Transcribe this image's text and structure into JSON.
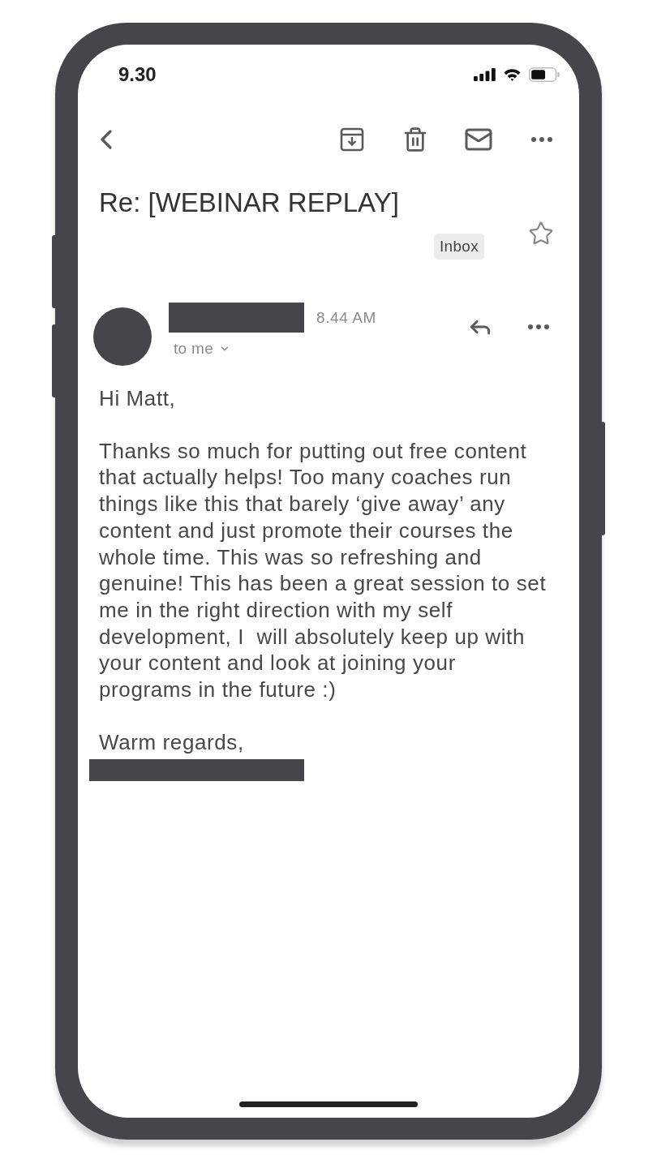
{
  "status_bar": {
    "time": "9.30"
  },
  "message": {
    "subject": "Re: [WEBINAR REPLAY]",
    "label": "Inbox",
    "starred": false,
    "sender": {
      "time": "8.44 AM",
      "recipient": "to me"
    },
    "body": {
      "greeting": "Hi Matt,",
      "paragraph_lines": [
        "Thanks so much for putting out free content",
        "that actually helps! Too many coaches run",
        "things like this that barely ‘give away’ any",
        "content and just promote their courses the",
        "whole time. This was so refreshing and",
        "genuine! This has been a great session to set",
        "me in the right direction with my self",
        "development, I  will absolutely keep up with",
        "your content and look at joining your",
        "programs in the future :)"
      ],
      "closing": "Warm regards,"
    }
  }
}
